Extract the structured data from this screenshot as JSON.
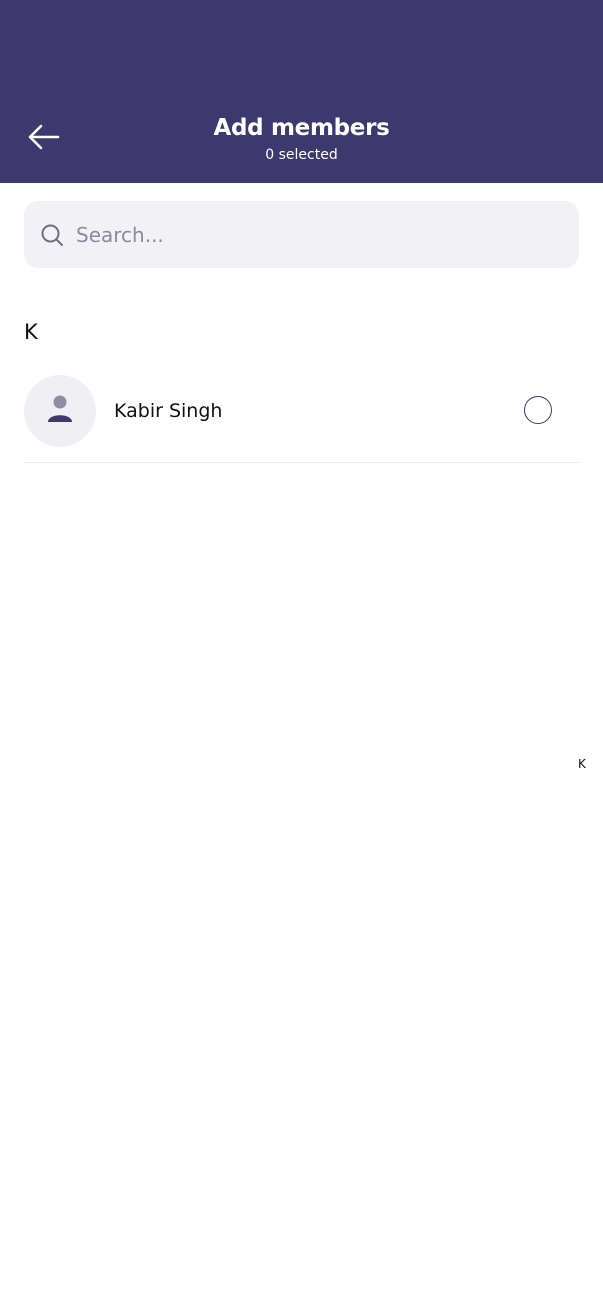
{
  "header": {
    "title": "Add members",
    "subtitle": "0 selected",
    "background_color": "#3d386e",
    "back_icon": "arrow-left-icon"
  },
  "search": {
    "placeholder": "Search...",
    "value": "",
    "icon": "search-icon"
  },
  "sections": [
    {
      "letter": "K",
      "contacts": [
        {
          "name": "Kabir Singh",
          "avatar_icon": "person-icon",
          "selected": false
        }
      ]
    }
  ],
  "alphabet_index": [
    "K"
  ]
}
